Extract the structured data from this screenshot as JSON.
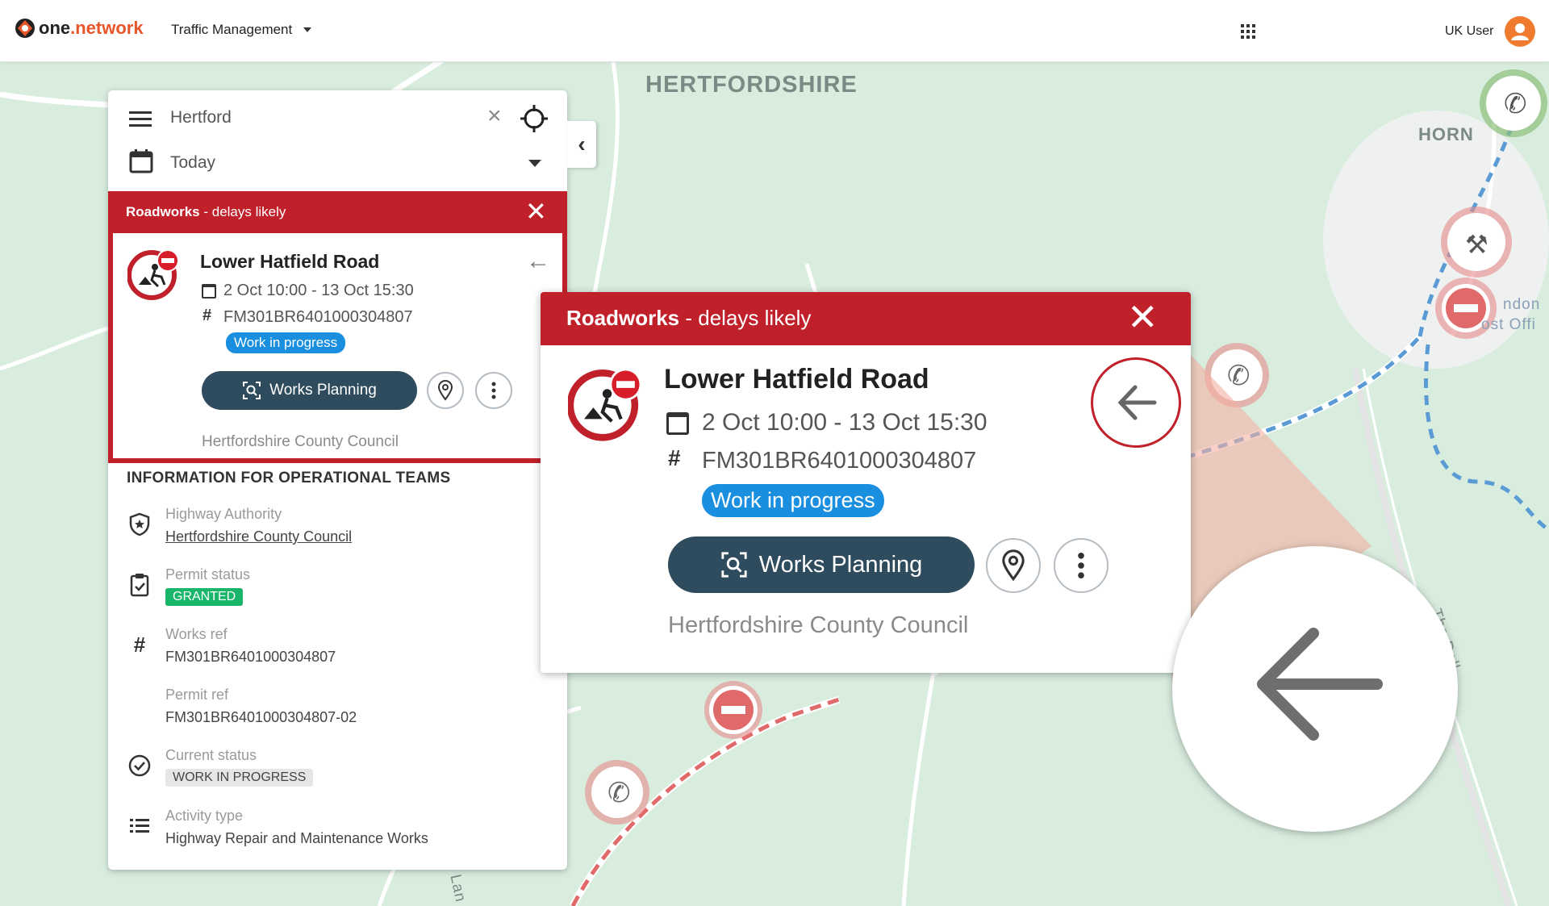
{
  "topbar": {
    "logo_one": "one",
    "logo_network": ".network",
    "app_name": "Traffic Management",
    "user_name": "UK User"
  },
  "map": {
    "labels": [
      "HERTFORDSHIRE",
      "HORN",
      "ndon",
      "ost Offi",
      "The Dell",
      "Lan"
    ]
  },
  "panel": {
    "search_value": "Hertford",
    "date_value": "Today",
    "alert": {
      "type": "Roadworks",
      "suffix": " - delays likely",
      "road": "Lower Hatfield Road",
      "dates": "2 Oct 10:00 - 13 Oct 15:30",
      "reference": "FM301BR6401000304807",
      "status": "Work in progress",
      "works_button": "Works Planning",
      "authority": "Hertfordshire County Council"
    },
    "ops": {
      "title": "INFORMATION FOR OPERATIONAL TEAMS",
      "items": [
        {
          "label": "Highway Authority",
          "value": "Hertfordshire County Council"
        },
        {
          "label": "Permit status",
          "value": "GRANTED"
        },
        {
          "label": "Works ref",
          "value": "FM301BR6401000304807"
        },
        {
          "label": "Permit ref",
          "value": "FM301BR6401000304807-02"
        },
        {
          "label": "Current status",
          "value": "WORK IN PROGRESS"
        },
        {
          "label": "Activity type",
          "value": "Highway Repair and Maintenance Works"
        }
      ]
    }
  },
  "colors": {
    "alert_red": "#c0202a",
    "status_blue": "#1a8fe0",
    "granted_green": "#18b56a",
    "button_navy": "#2f4b5e",
    "brand_orange": "#e8552b"
  }
}
